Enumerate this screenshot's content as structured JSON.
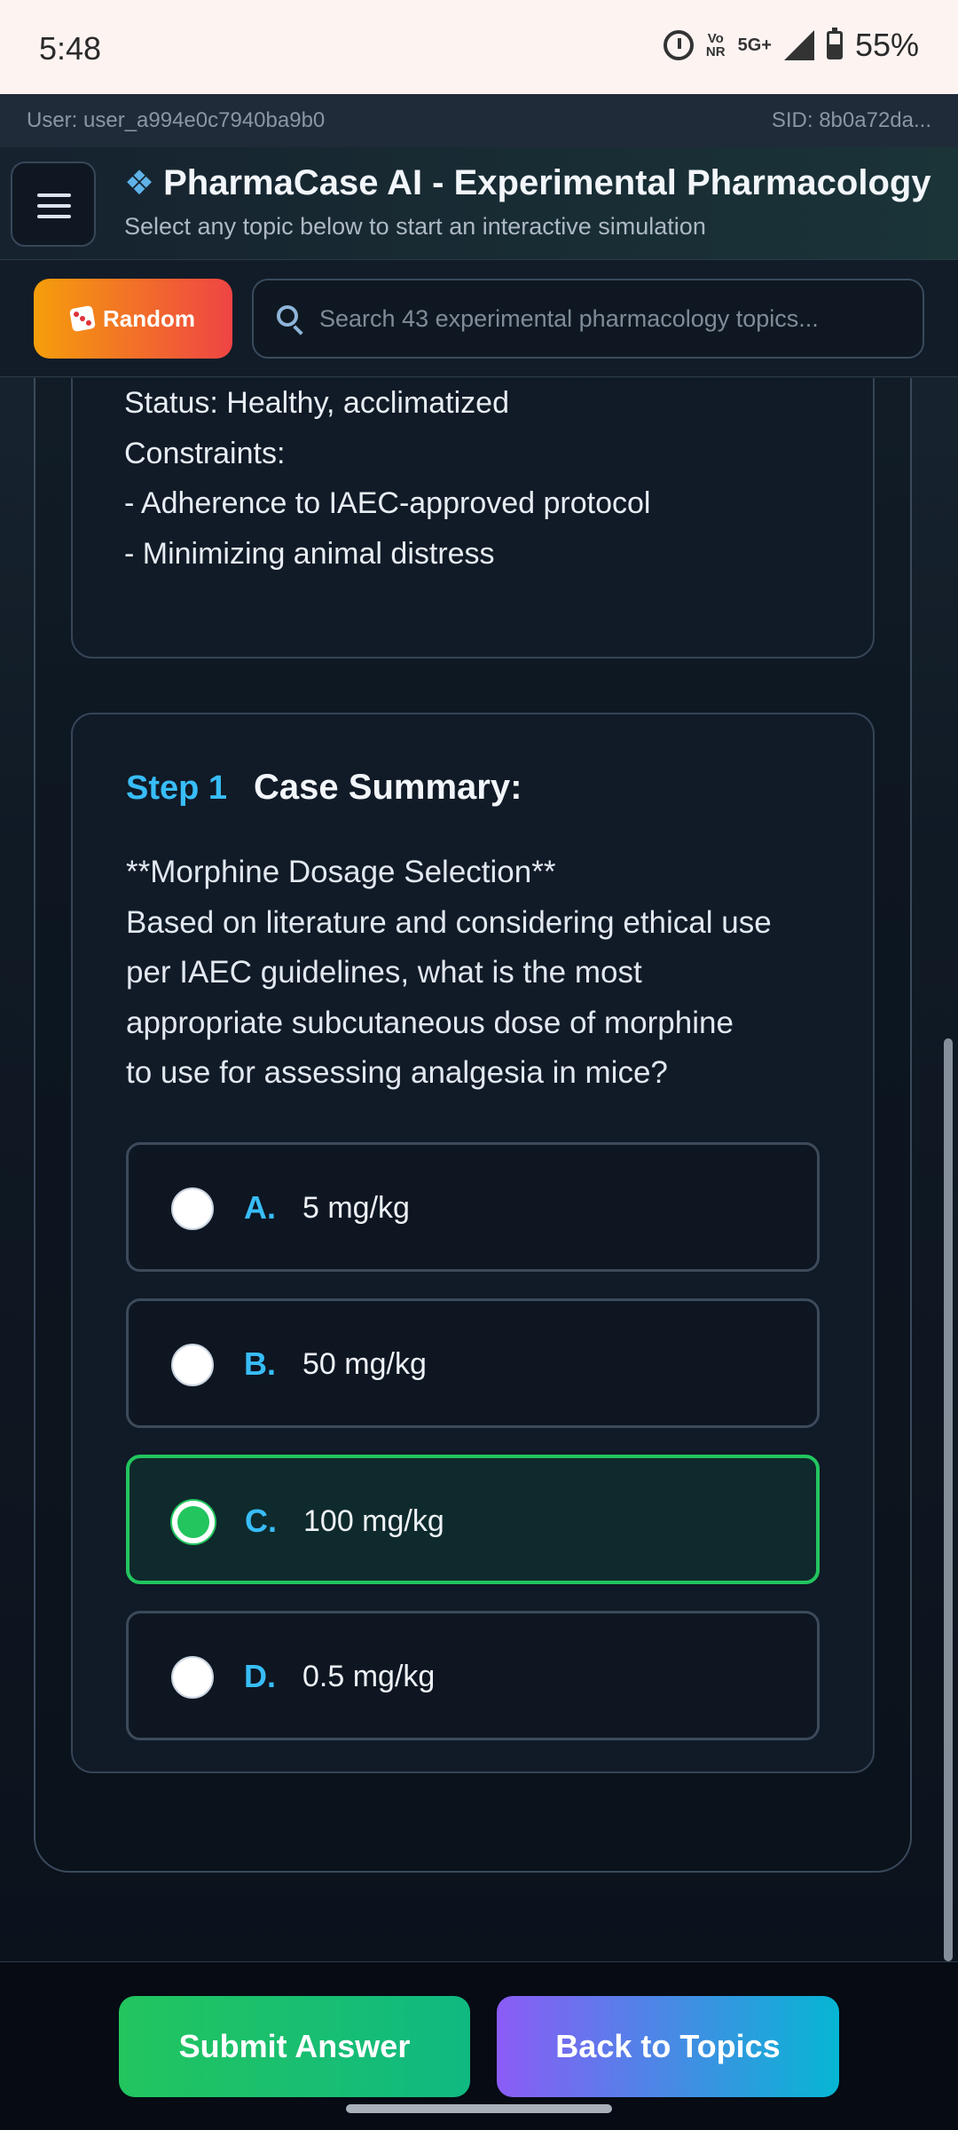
{
  "status_bar": {
    "time": "5:48",
    "net_top": "Vo",
    "net_bottom": "NR",
    "network": "5G+",
    "battery": "55%"
  },
  "user_strip": {
    "user": "User: user_a994e0c7940ba9b0",
    "sid": "SID: 8b0a72da..."
  },
  "header": {
    "icon": "paw-icon",
    "title": "PharmaCase AI - Experimental Pharmacology",
    "subtitle": "Select any topic below to start an interactive simulation"
  },
  "toolbar": {
    "random_label": "Random",
    "search_placeholder": "Search 43 experimental pharmacology topics..."
  },
  "scenario": {
    "lines": [
      "Status: Healthy, acclimatized",
      "Constraints:",
      "- Adherence to IAEC-approved protocol",
      "- Minimizing animal distress"
    ]
  },
  "question": {
    "step_label": "Step 1",
    "step_title": "Case Summary:",
    "lines": [
      "**Morphine Dosage Selection**",
      "Based on literature and considering ethical use",
      "per IAEC guidelines, what is the most",
      "appropriate subcutaneous dose of morphine",
      "to use for assessing analgesia in mice?"
    ],
    "options": [
      {
        "letter": "A.",
        "text": "5 mg/kg"
      },
      {
        "letter": "B.",
        "text": "50 mg/kg"
      },
      {
        "letter": "C.",
        "text": "100 mg/kg"
      },
      {
        "letter": "D.",
        "text": "0.5 mg/kg"
      }
    ],
    "selected_option": "C."
  },
  "actions": {
    "submit": "Submit Answer",
    "back": "Back to Topics"
  },
  "colors": {
    "accent_cyan": "#38bdf8",
    "selected_green": "#22c55e"
  }
}
